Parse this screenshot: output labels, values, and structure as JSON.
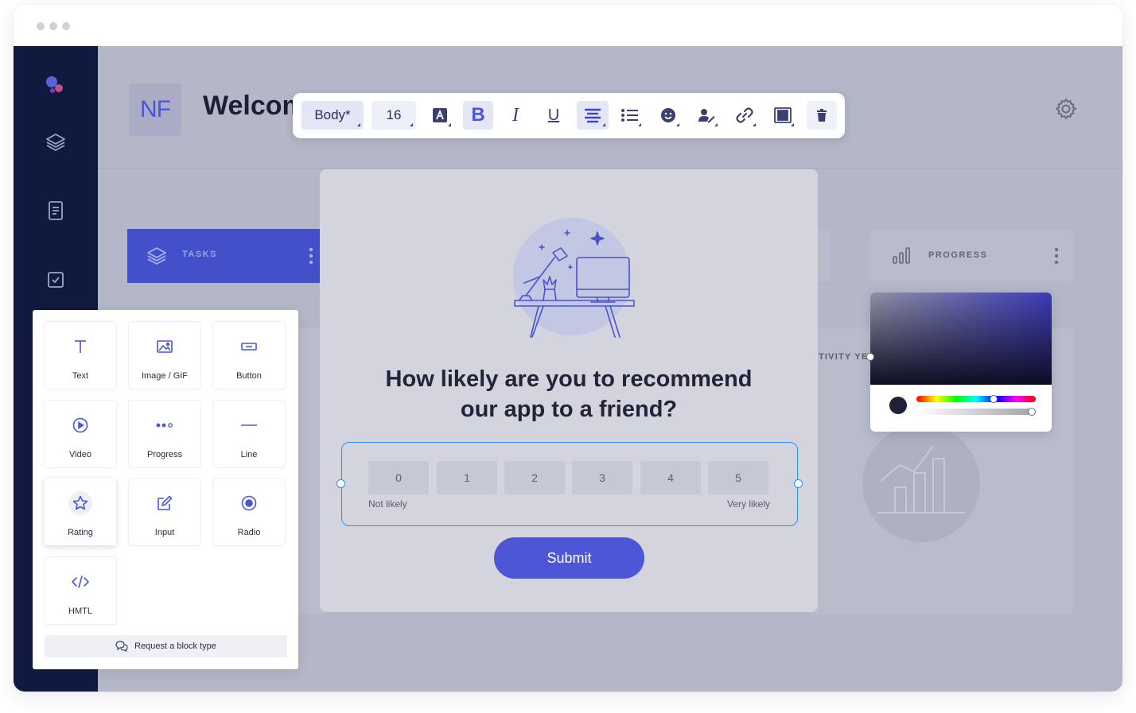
{
  "header": {
    "avatar_initials": "NF",
    "title": "Welcom"
  },
  "toolbar": {
    "style_label": "Body*",
    "font_size": "16",
    "bold_label": "B",
    "italic_label": "I",
    "underline_label": "U"
  },
  "cards": {
    "tasks_label": "TASKS",
    "progress_label": "PROGRESS",
    "activity_label": "TIVITY YE"
  },
  "survey": {
    "question_line1": "How likely are you to recommend",
    "question_line2": "our app to a friend?",
    "options": [
      "0",
      "1",
      "2",
      "3",
      "4",
      "5"
    ],
    "low_label": "Not likely",
    "high_label": "Very likely",
    "submit_label": "Submit"
  },
  "blocks": {
    "items": [
      {
        "label": "Text",
        "icon": "text-icon"
      },
      {
        "label": "Image / GIF",
        "icon": "image-icon"
      },
      {
        "label": "Button",
        "icon": "button-icon"
      },
      {
        "label": "Video",
        "icon": "play-icon"
      },
      {
        "label": "Progress",
        "icon": "dots-icon"
      },
      {
        "label": "Line",
        "icon": "line-icon"
      },
      {
        "label": "Rating",
        "icon": "star-icon"
      },
      {
        "label": "Input",
        "icon": "edit-icon"
      },
      {
        "label": "Radio",
        "icon": "radio-icon"
      },
      {
        "label": "HMTL",
        "icon": "code-icon"
      }
    ],
    "request_label": "Request a block type"
  },
  "colors": {
    "accent": "#4c56d6",
    "sidebar": "#0f1a3e",
    "selection": "#2f8ff0",
    "picked_color": "#1f2135"
  }
}
